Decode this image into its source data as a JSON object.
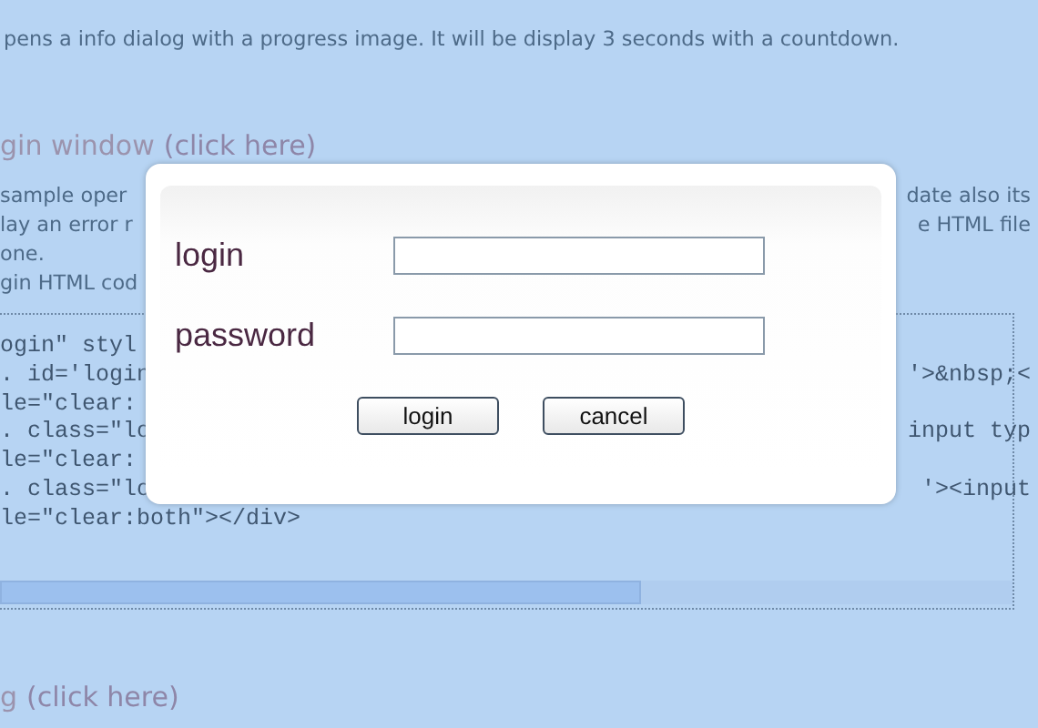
{
  "intro_text": "pens a info dialog with a progress image. It will be display 3 seconds with a countdown.",
  "login_heading": {
    "title": "gin window",
    "link": "(click here)"
  },
  "description_lines": [
    {
      "left": "sample oper",
      "right": "date also its"
    },
    {
      "left": "lay an error r",
      "right": "e HTML file"
    },
    {
      "left": "one."
    },
    {
      "left": "gin HTML cod"
    }
  ],
  "code_lines": [
    {
      "left": "ogin\" styl"
    },
    {
      "left": ". id='login",
      "right": "'>&nbsp;<"
    },
    {
      "left": "le=\"clear:"
    },
    {
      "left": ". class=\"lo",
      "right": "input typ"
    },
    {
      "left": "le=\"clear:"
    },
    {
      "left": ". class=\"lo",
      "right": "'><input"
    },
    {
      "left": "le=\"clear:both\"></div>"
    }
  ],
  "next_heading": {
    "title": "g",
    "link": "(click here)"
  },
  "dialog": {
    "fields": [
      {
        "label": "login"
      },
      {
        "label": "password"
      }
    ],
    "buttons": [
      "login",
      "cancel"
    ]
  }
}
